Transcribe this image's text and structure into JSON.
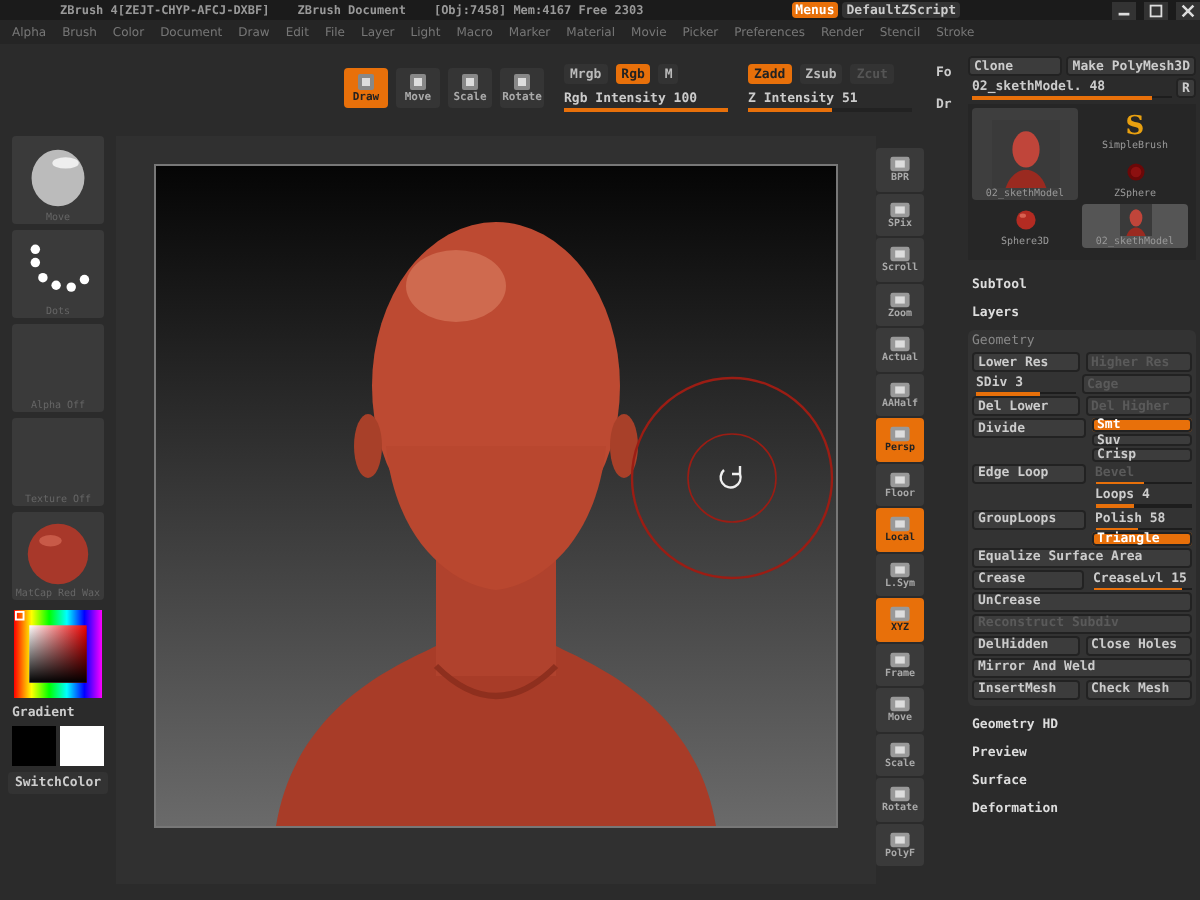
{
  "title_bar": {
    "app": "ZBrush 4[ZEJT-CHYP-AFCJ-DXBF]",
    "document": "ZBrush Document",
    "stats": "[Obj:7458] Mem:4167 Free 2303",
    "buttons": [
      {
        "label": "Menus",
        "on": true
      },
      {
        "label": "DefaultZScript",
        "on": false
      }
    ]
  },
  "menus": [
    "Alpha",
    "Brush",
    "Color",
    "Document",
    "Draw",
    "Edit",
    "File",
    "Layer",
    "Light",
    "Macro",
    "Marker",
    "Material",
    "Movie",
    "Picker",
    "Preferences",
    "Render",
    "Stencil",
    "Stroke"
  ],
  "toolbar": {
    "tools": [
      {
        "label": "Draw",
        "on": true
      },
      {
        "label": "Move",
        "on": false
      },
      {
        "label": "Scale",
        "on": false
      },
      {
        "label": "Rotate",
        "on": false
      }
    ],
    "color_modes": [
      {
        "label": "Mrgb",
        "on": false,
        "disabled": false
      },
      {
        "label": "Rgb",
        "on": true,
        "disabled": false
      },
      {
        "label": "M",
        "on": false,
        "disabled": false
      }
    ],
    "z_modes": [
      {
        "label": "Zadd",
        "on": true,
        "disabled": false
      },
      {
        "label": "Zsub",
        "on": false,
        "disabled": false
      },
      {
        "label": "Zcut",
        "on": false,
        "disabled": true
      }
    ],
    "sliders": [
      {
        "label": "Rgb Intensity 100",
        "level": 1
      },
      {
        "label": "Z Intensity 51",
        "level": 0.51
      }
    ],
    "cut_labels": [
      "Fo",
      "Dr"
    ]
  },
  "left_shelf": [
    {
      "kind": "material",
      "label": "Move"
    },
    {
      "kind": "stroke",
      "label": "Dots"
    },
    {
      "kind": "empty",
      "label": "Alpha Off"
    },
    {
      "kind": "empty",
      "label": "Texture Off"
    },
    {
      "kind": "matcap",
      "label": "MatCap Red Wax"
    }
  ],
  "color_panel": {
    "label": "Gradient",
    "switch": "SwitchColor"
  },
  "right_shelf": [
    {
      "label": "BPR",
      "on": false
    },
    {
      "label": "SPix",
      "on": false
    },
    {
      "label": "Scroll",
      "on": false
    },
    {
      "label": "Zoom",
      "on": false
    },
    {
      "label": "Actual",
      "on": false
    },
    {
      "label": "AAHalf",
      "on": false
    },
    {
      "label": "Persp",
      "on": true
    },
    {
      "label": "Floor",
      "on": false
    },
    {
      "label": "Local",
      "on": true
    },
    {
      "label": "L.Sym",
      "on": false
    },
    {
      "label": "XYZ",
      "on": true
    },
    {
      "label": "Frame",
      "on": false
    },
    {
      "label": "Move",
      "on": false
    },
    {
      "label": "Scale",
      "on": false
    },
    {
      "label": "Rotate",
      "on": false
    },
    {
      "label": "PolyF",
      "on": false
    }
  ],
  "tool_panel": {
    "top_buttons": [
      "Clone",
      "Make PolyMesh3D"
    ],
    "tool_slider": {
      "label": "02_skethModel. 48",
      "level": 0.9
    },
    "r_button": "R",
    "thumbnails": [
      {
        "kind": "head",
        "label": "02_skethModel",
        "selected": false
      },
      {
        "kind": "sphere",
        "label": "Sphere3D",
        "selected": false
      },
      {
        "kind": "glyph",
        "glyph": "S",
        "label": "SimpleBrush",
        "selected": false
      },
      {
        "kind": "zsphere",
        "label": "ZSphere",
        "selected": false
      },
      {
        "kind": "head",
        "label": "02_skethModel",
        "selected": true
      }
    ]
  },
  "sections_above": [
    "SubTool",
    "Layers"
  ],
  "geometry": {
    "title": "Geometry",
    "rows": [
      {
        "cells": [
          {
            "kind": "button",
            "label": "Lower Res",
            "disabled": false
          },
          {
            "kind": "button",
            "label": "Higher Res",
            "disabled": true
          }
        ]
      },
      {
        "cells": [
          {
            "kind": "slider",
            "label": "SDiv 3",
            "level": 0.65,
            "disabled": false
          },
          {
            "kind": "button",
            "label": "Cage",
            "disabled": true
          }
        ]
      },
      {
        "cells": [
          {
            "kind": "button",
            "label": "Del Lower",
            "disabled": false
          },
          {
            "kind": "button",
            "label": "Del Higher",
            "disabled": true
          }
        ]
      },
      {
        "cells": [
          {
            "kind": "button",
            "label": "Divide",
            "disabled": false
          },
          {
            "kind": "stack",
            "items": [
              {
                "kind": "toggle",
                "label": "Smt",
                "on": true,
                "disabled": false
              },
              {
                "kind": "toggle",
                "label": "Suv",
                "on": false,
                "disabled": false
              },
              {
                "kind": "toggle",
                "label": "Crisp",
                "on": false,
                "disabled": false
              }
            ]
          }
        ]
      },
      {
        "cells": [
          {
            "kind": "button",
            "label": "Edge Loop",
            "disabled": false
          },
          {
            "kind": "stack",
            "items": [
              {
                "kind": "slider",
                "label": "Bevel",
                "level": 0.5,
                "disabled": true
              },
              {
                "kind": "slider",
                "label": "Loops 4",
                "level": 0.4,
                "disabled": false
              }
            ]
          }
        ]
      },
      {
        "cells": [
          {
            "kind": "button",
            "label": "GroupLoops",
            "disabled": false
          },
          {
            "kind": "stack",
            "items": [
              {
                "kind": "slider",
                "label": "Polish 58",
                "level": 0.45,
                "disabled": false
              },
              {
                "kind": "toggle",
                "label": "Triangle",
                "on": true,
                "disabled": false
              }
            ]
          }
        ]
      },
      {
        "cells": [
          {
            "kind": "button",
            "label": "Equalize Surface Area",
            "disabled": false
          }
        ]
      },
      {
        "cells": [
          {
            "kind": "button",
            "label": "Crease",
            "disabled": false
          },
          {
            "kind": "slider",
            "label": "CreaseLvl 15",
            "level": 0.9,
            "disabled": false
          }
        ]
      },
      {
        "cells": [
          {
            "kind": "button",
            "label": "UnCrease",
            "disabled": false
          }
        ]
      },
      {
        "cells": [
          {
            "kind": "button",
            "label": "Reconstruct Subdiv",
            "disabled": true
          }
        ]
      },
      {
        "cells": [
          {
            "kind": "button",
            "label": "DelHidden",
            "disabled": false
          },
          {
            "kind": "button",
            "label": "Close Holes",
            "disabled": false
          }
        ]
      },
      {
        "cells": [
          {
            "kind": "button",
            "label": "Mirror And Weld",
            "disabled": false
          }
        ]
      },
      {
        "cells": [
          {
            "kind": "button",
            "label": "InsertMesh",
            "disabled": false
          },
          {
            "kind": "button",
            "label": "Check Mesh",
            "disabled": false
          }
        ]
      }
    ]
  },
  "sections_below": [
    "Geometry HD",
    "Preview",
    "Surface",
    "Deformation"
  ]
}
